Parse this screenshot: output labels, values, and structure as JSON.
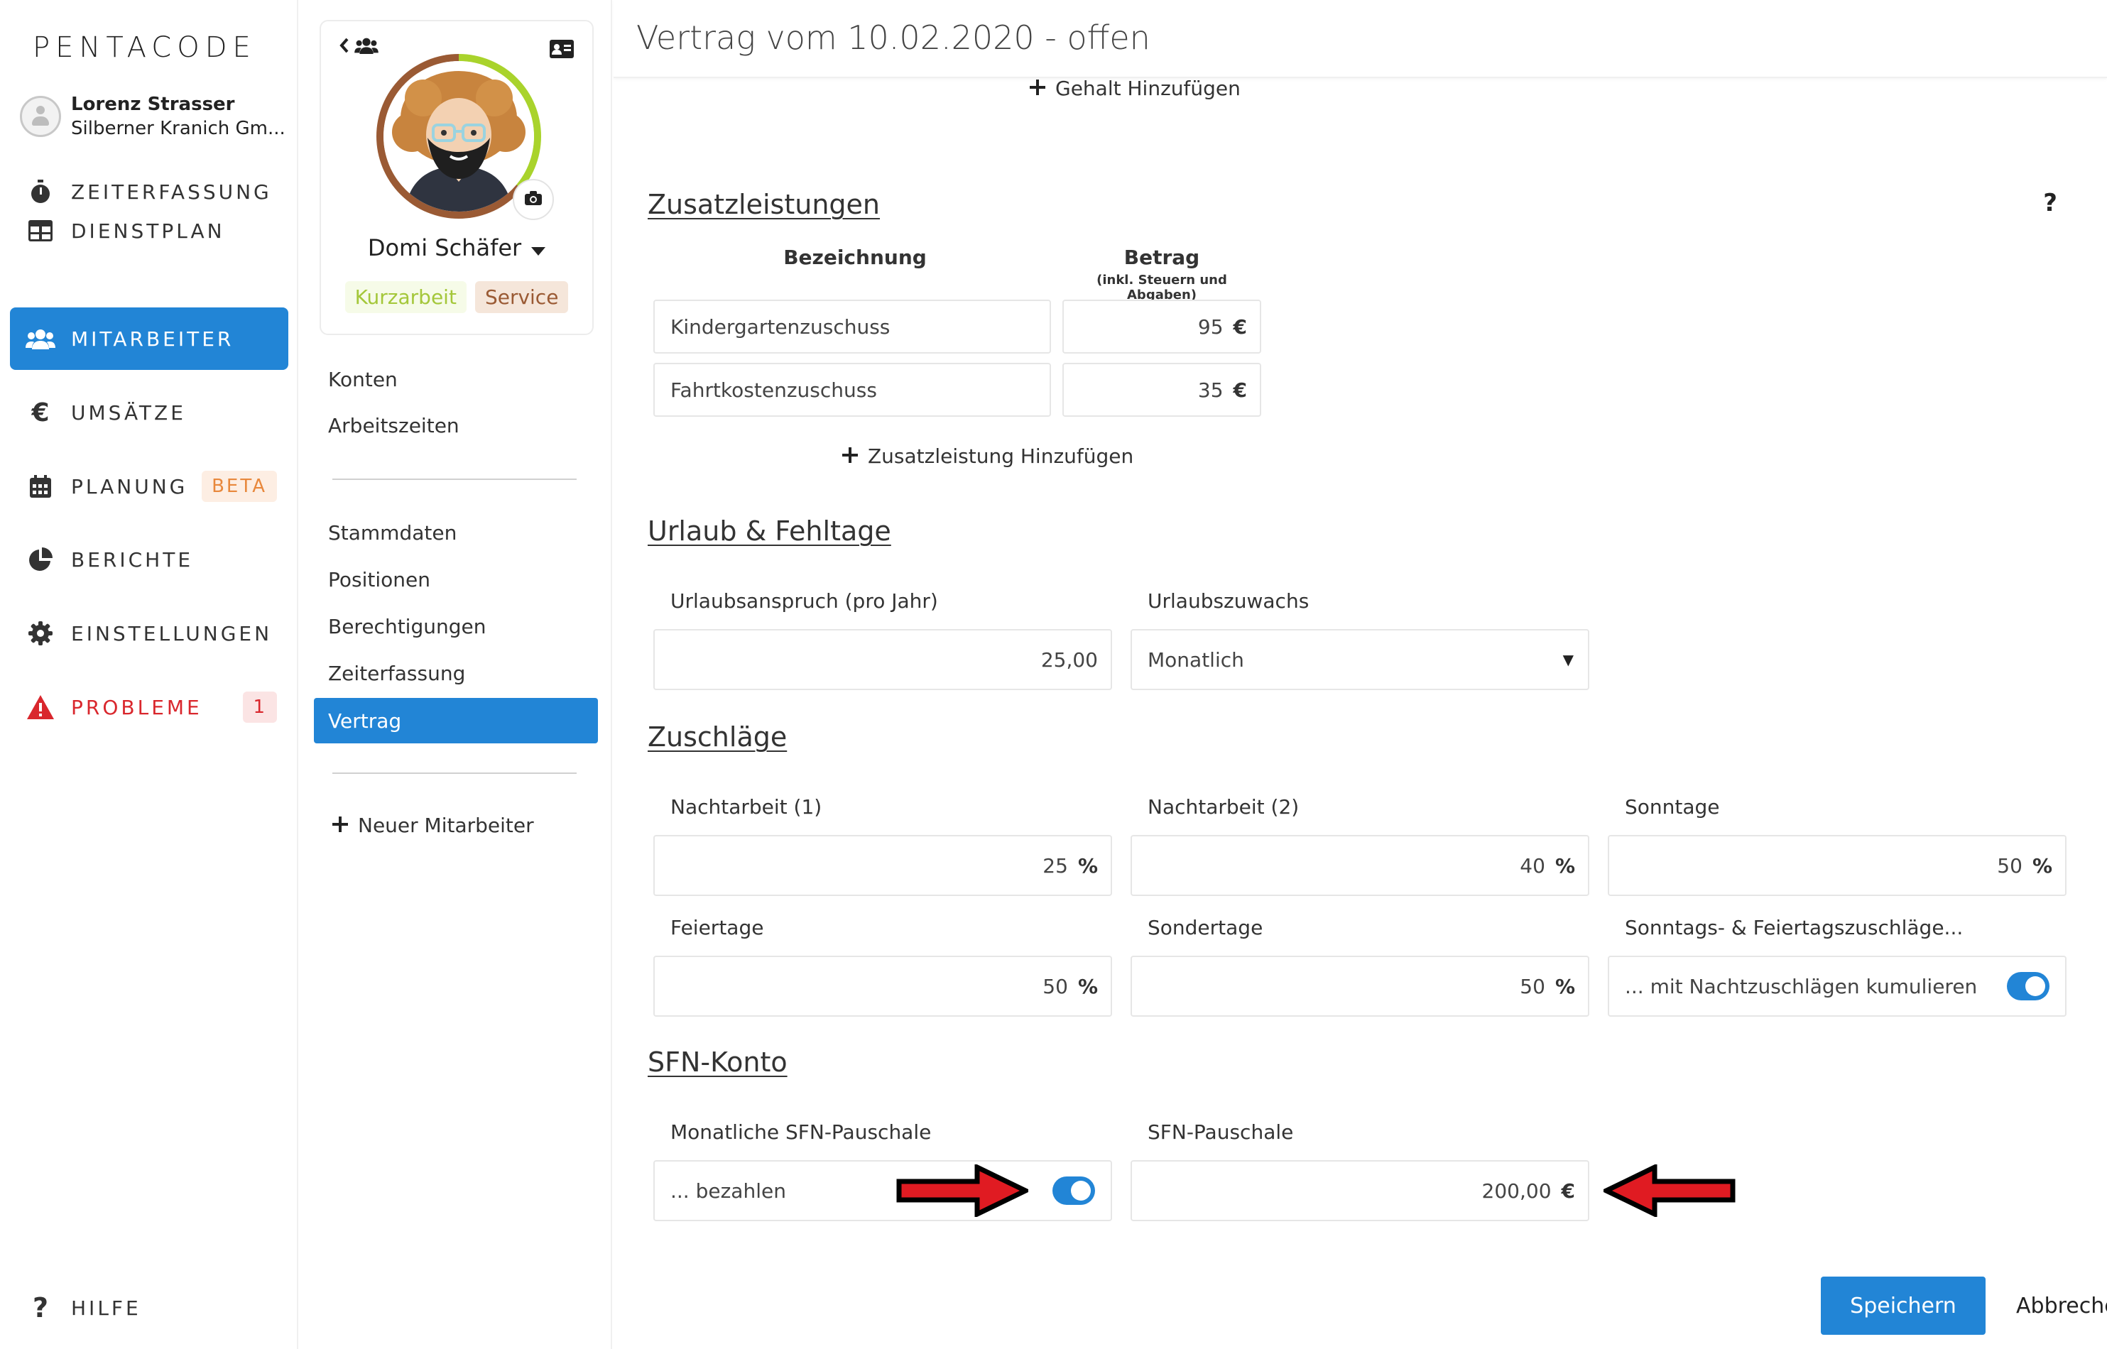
{
  "app": {
    "logo": "PENTACODE",
    "user_name": "Lorenz Strasser",
    "user_company": "Silberner Kranich Gm..."
  },
  "nav": {
    "items": [
      {
        "label": "ZEITERFASSUNG",
        "icon": "stopwatch-icon"
      },
      {
        "label": "DIENSTPLAN",
        "icon": "table-icon"
      },
      {
        "label": "MITARBEITER",
        "icon": "users-icon",
        "active": true
      },
      {
        "label": "UMSÄTZE",
        "icon": "euro-icon"
      },
      {
        "label": "PLANUNG",
        "icon": "calendar-icon",
        "badge": "BETA"
      },
      {
        "label": "BERICHTE",
        "icon": "pie-chart-icon"
      },
      {
        "label": "EINSTELLUNGEN",
        "icon": "gear-icon"
      },
      {
        "label": "PROBLEME",
        "icon": "warning-icon",
        "badge": "1"
      }
    ],
    "help_label": "HILFE"
  },
  "profile": {
    "name": "Domi Schäfer",
    "tags": [
      "Kurzarbeit",
      "Service"
    ]
  },
  "submenu": {
    "group1": [
      "Konten",
      "Arbeitszeiten"
    ],
    "group2": [
      "Stammdaten",
      "Positionen",
      "Berechtigungen",
      "Zeiterfassung",
      "Vertrag"
    ],
    "active": "Vertrag",
    "new_employee": "Neuer Mitarbeiter"
  },
  "main": {
    "title": "Vertrag vom 10.02.2020 - offen",
    "add_salary": "Gehalt Hinzufügen",
    "help": "?"
  },
  "zusatz": {
    "title": "Zusatzleistungen",
    "col_name": "Bezeichnung",
    "col_amount": "Betrag",
    "col_amount_sub": "(inkl. Steuern und Abgaben)",
    "rows": [
      {
        "name": "Kindergartenzuschuss",
        "amount": "95",
        "unit": "€"
      },
      {
        "name": "Fahrtkostenzuschuss",
        "amount": "35",
        "unit": "€"
      }
    ],
    "add_label": "Zusatzleistung Hinzufügen"
  },
  "urlaub": {
    "title": "Urlaub & Fehltage",
    "anspruch_label": "Urlaubsanspruch (pro Jahr)",
    "anspruch_value": "25,00",
    "zuwachs_label": "Urlaubszuwachs",
    "zuwachs_value": "Monatlich"
  },
  "zuschlaege": {
    "title": "Zuschläge",
    "nacht1_label": "Nachtarbeit (1)",
    "nacht1_value": "25",
    "nacht2_label": "Nachtarbeit (2)",
    "nacht2_value": "40",
    "sonntag_label": "Sonntage",
    "sonntag_value": "50",
    "feiertag_label": "Feiertage",
    "feiertag_value": "50",
    "sondertag_label": "Sondertage",
    "sondertag_value": "50",
    "kumul_label": "Sonntags- & Feiertagszuschläge...",
    "kumul_value": "... mit Nachtzuschlägen kumulieren",
    "percent": "%"
  },
  "sfn": {
    "title": "SFN-Konto",
    "monthly_label": "Monatliche SFN-Pauschale",
    "monthly_value": "... bezahlen",
    "pauschale_label": "SFN-Pauschale",
    "pauschale_value": "200,00",
    "unit": "€"
  },
  "actions": {
    "save": "Speichern",
    "cancel": "Abbrechen"
  },
  "colors": {
    "primary": "#2285d6",
    "danger": "#d9272d",
    "beta": "#e8883c",
    "tag_green": "#a4c73a",
    "tag_brown": "#9a5a34",
    "arrow": "#e01b22"
  }
}
